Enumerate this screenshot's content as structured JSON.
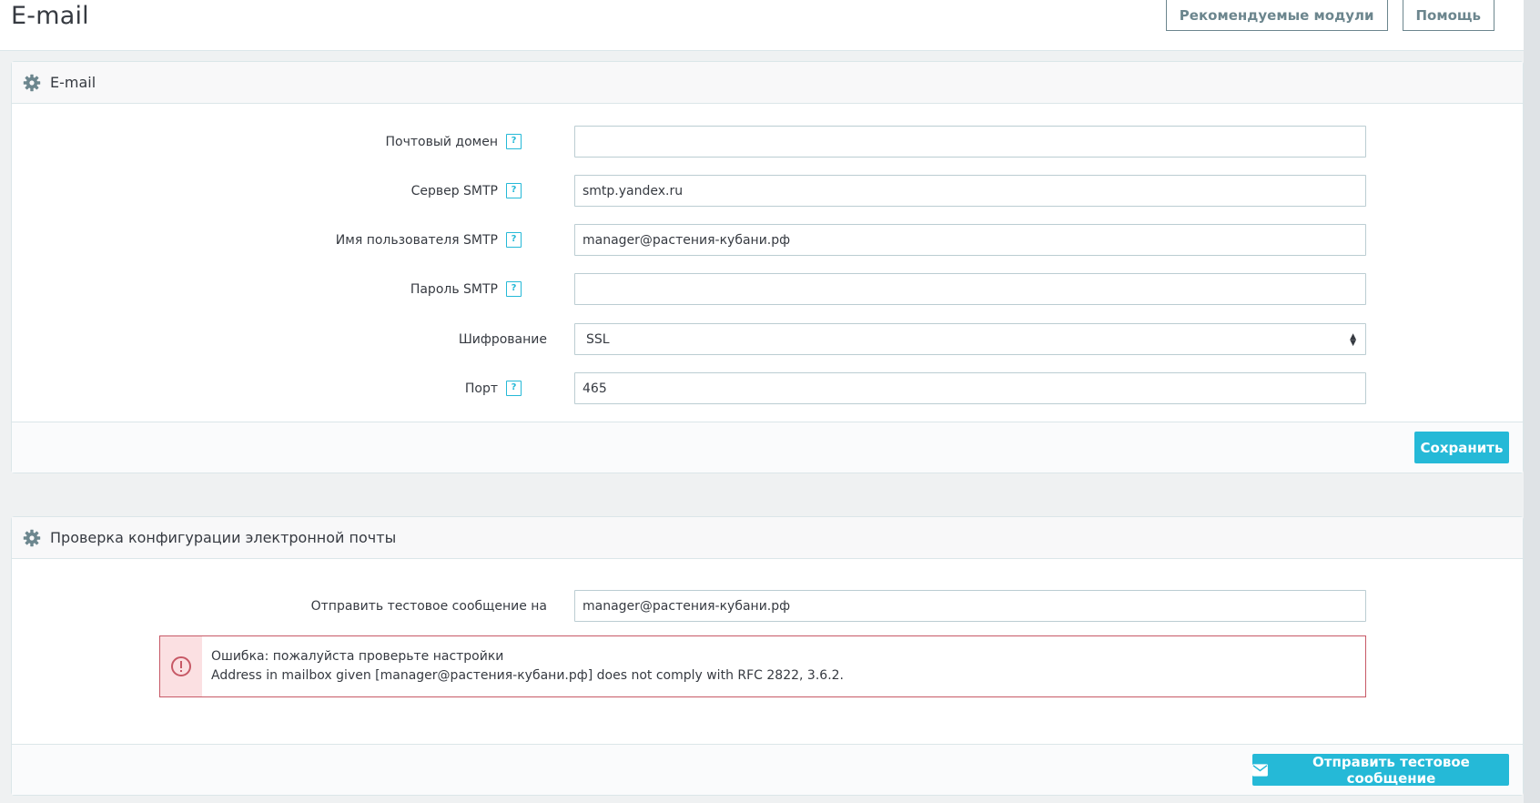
{
  "header": {
    "title": "E-mail",
    "recommended_modules_label": "Рекомендуемые модули",
    "help_label": "Помощь"
  },
  "email_panel": {
    "title": "E-mail",
    "fields": {
      "mail_domain": {
        "label": "Почтовый домен",
        "value": ""
      },
      "smtp_server": {
        "label": "Сервер SMTP",
        "value": "smtp.yandex.ru"
      },
      "smtp_user": {
        "label": "Имя пользователя SMTP",
        "value": "manager@растения-кубани.рф"
      },
      "smtp_password": {
        "label": "Пароль SMTP",
        "value": ""
      },
      "encryption": {
        "label": "Шифрование",
        "value": "SSL"
      },
      "port": {
        "label": "Порт",
        "value": "465"
      }
    },
    "help_glyph": "?",
    "save_label": "Сохранить"
  },
  "test_panel": {
    "title": "Проверка конфигурации электронной почты",
    "send_to_label": "Отправить тестовое сообщение на",
    "send_to_value": "manager@растения-кубани.рф",
    "error_title": "Ошибка: пожалуйста проверьте настройки",
    "error_detail": "Address in mailbox given [manager@растения-кубани.рф] does not comply with RFC 2822, 3.6.2.",
    "send_button_label": "Отправить тестовое сообщение"
  },
  "colors": {
    "accent": "#25b9d7",
    "error_border": "#c75966",
    "error_bg": "#fbe0e2"
  },
  "icons": {
    "panel_icon": "gear-icon",
    "help_icon": "help-icon",
    "error_icon": "exclamation-circle-icon",
    "send_icon": "envelope-icon"
  }
}
